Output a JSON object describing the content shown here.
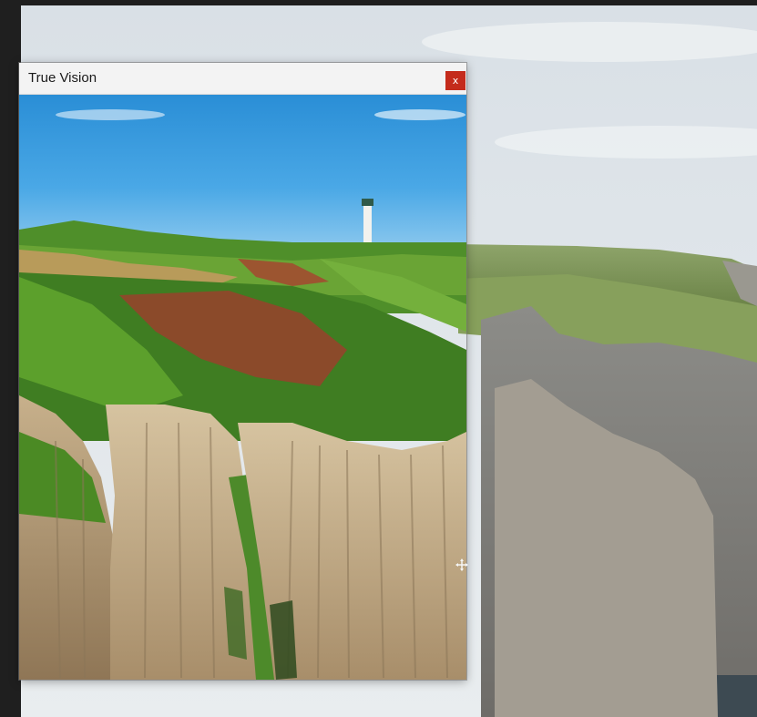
{
  "window": {
    "title": "True Vision",
    "close_label": "x"
  },
  "desktop": {
    "background": "coastal-cliffs-lighthouse-photo"
  },
  "overlay": {
    "content": "coastal-cliffs-lighthouse-photo-vivid"
  },
  "icons": {
    "close": "close-icon",
    "cursor": "move-cursor-icon"
  },
  "colors": {
    "close_button": "#c42b1c",
    "titlebar": "#f3f3f3",
    "sky": "#3fa0e0",
    "grass": "#5a9a2a",
    "cliff": "#c9b189"
  }
}
